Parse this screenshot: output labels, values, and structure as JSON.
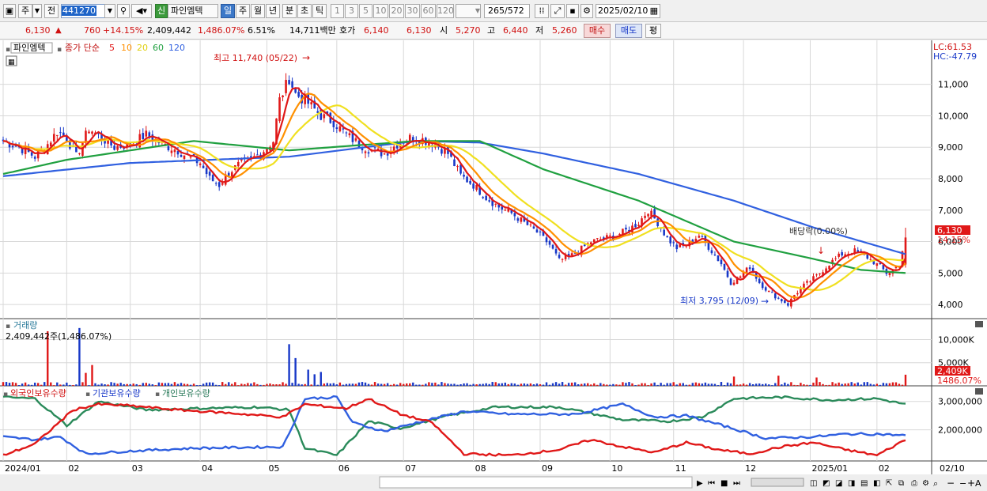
{
  "toolbar": {
    "dir_prev": "주",
    "dir_next": "전",
    "code": "441270",
    "stock_badge": "신",
    "stock_name": "파인엠텍",
    "periods": [
      "일",
      "주",
      "월",
      "년",
      "분",
      "초",
      "틱"
    ],
    "numbers": [
      "1",
      "3",
      "5",
      "10",
      "20",
      "30",
      "60",
      "120"
    ],
    "count": "265",
    "total": "/572",
    "date": "2025/02/10"
  },
  "quote": {
    "price": "6,130",
    "change": "760",
    "change_pct": "+14.15%",
    "volume": "2,409,442",
    "volume_pct": "1,486.07%",
    "turnover_pct": "6.51%",
    "amount": "14,711백만",
    "ask_label": "호가",
    "ask": "6,140",
    "bid": "6,130",
    "open_label": "시",
    "open": "5,270",
    "high_label": "고",
    "high": "6,440",
    "low_label": "저",
    "low": "5,260",
    "buy_label": "매수",
    "sell_label": "매도",
    "avg_label": "평"
  },
  "colors": {
    "up": "#e01818",
    "down": "#1838c8",
    "ma5": "#e01818",
    "ma10": "#ff9000",
    "ma20": "#f0e020",
    "ma60": "#20a040",
    "ma120": "#3060e0"
  },
  "chart_data": {
    "type": "line",
    "price_panel": {
      "legend": {
        "name": "파인엠텍",
        "series_label": "종가 단순",
        "periods": [
          "5",
          "10",
          "20",
          "60",
          "120"
        ]
      },
      "yticks": [
        "11,000",
        "10,000",
        "9,000",
        "8,000",
        "7,000",
        "6,000",
        "5,000",
        "4,000"
      ],
      "ytick_values": [
        11000,
        10000,
        9000,
        8000,
        7000,
        6000,
        5000,
        4000
      ],
      "ylim": [
        3550,
        12400
      ],
      "lc": "LC:61.53",
      "hc": "HC:-47.79",
      "last_price_label": "6,130",
      "last_pct_label": "14.15%",
      "max_label": "최고 11,740 (05/22)",
      "min_label": "최저 3,795 (12/09)",
      "dividend_label": "배당락(0.00%)",
      "close_anchor": [
        [
          0,
          9200
        ],
        [
          5,
          9000
        ],
        [
          10,
          8700
        ],
        [
          14,
          9100
        ],
        [
          17,
          9500
        ],
        [
          20,
          9300
        ],
        [
          23,
          8700
        ],
        [
          27,
          9600
        ],
        [
          31,
          9300
        ],
        [
          35,
          9000
        ],
        [
          40,
          9100
        ],
        [
          45,
          9400
        ],
        [
          50,
          9100
        ],
        [
          55,
          8900
        ],
        [
          58,
          8700
        ],
        [
          62,
          8500
        ],
        [
          65,
          8000
        ],
        [
          68,
          7800
        ],
        [
          71,
          8200
        ],
        [
          75,
          8500
        ],
        [
          78,
          8600
        ],
        [
          82,
          8900
        ],
        [
          85,
          9200
        ],
        [
          87,
          10500
        ],
        [
          90,
          11200
        ],
        [
          92,
          10700
        ],
        [
          96,
          10400
        ],
        [
          100,
          10000
        ],
        [
          104,
          9800
        ],
        [
          108,
          9400
        ],
        [
          112,
          9100
        ],
        [
          116,
          8900
        ],
        [
          120,
          8800
        ],
        [
          124,
          9100
        ],
        [
          128,
          9300
        ],
        [
          132,
          9250
        ],
        [
          136,
          9100
        ],
        [
          140,
          8800
        ],
        [
          144,
          8100
        ],
        [
          148,
          7800
        ],
        [
          152,
          7400
        ],
        [
          156,
          7100
        ],
        [
          160,
          6900
        ],
        [
          164,
          6600
        ],
        [
          168,
          6300
        ],
        [
          172,
          5900
        ],
        [
          175,
          5400
        ],
        [
          178,
          5500
        ],
        [
          181,
          5700
        ],
        [
          185,
          6000
        ],
        [
          189,
          6100
        ],
        [
          193,
          6200
        ],
        [
          197,
          6400
        ],
        [
          200,
          6600
        ],
        [
          203,
          7000
        ],
        [
          206,
          6600
        ],
        [
          209,
          6100
        ],
        [
          212,
          5800
        ],
        [
          215,
          5900
        ],
        [
          219,
          6200
        ],
        [
          223,
          5700
        ],
        [
          226,
          5300
        ],
        [
          229,
          4700
        ],
        [
          232,
          4900
        ],
        [
          235,
          5200
        ],
        [
          238,
          4700
        ],
        [
          241,
          4400
        ],
        [
          244,
          4200
        ],
        [
          247,
          4000
        ],
        [
          249,
          4300
        ],
        [
          252,
          4600
        ],
        [
          256,
          4900
        ],
        [
          260,
          5300
        ],
        [
          264,
          5600
        ],
        [
          268,
          5700
        ],
        [
          272,
          5500
        ],
        [
          276,
          5200
        ],
        [
          278,
          5000
        ],
        [
          280,
          5100
        ],
        [
          282,
          5300
        ],
        [
          284,
          6130
        ]
      ],
      "ma120_anchor": [
        [
          0,
          8080
        ],
        [
          40,
          8500
        ],
        [
          90,
          8700
        ],
        [
          130,
          9200
        ],
        [
          150,
          9150
        ],
        [
          170,
          8800
        ],
        [
          200,
          8150
        ],
        [
          230,
          7300
        ],
        [
          255,
          6450
        ],
        [
          284,
          5600
        ]
      ],
      "ma60_anchor": [
        [
          0,
          8150
        ],
        [
          20,
          8600
        ],
        [
          60,
          9200
        ],
        [
          90,
          8900
        ],
        [
          130,
          9200
        ],
        [
          150,
          9200
        ],
        [
          170,
          8300
        ],
        [
          200,
          7300
        ],
        [
          230,
          6000
        ],
        [
          255,
          5450
        ],
        [
          270,
          5100
        ],
        [
          284,
          5000
        ]
      ]
    },
    "volume_panel": {
      "title": "거래량",
      "value_label": "2,409,442주(1,486.07%)",
      "yticks": [
        "10,000K",
        "5,000K"
      ],
      "ytick_values": [
        10000,
        5000
      ],
      "ylim": [
        0,
        13500
      ],
      "last_vol_label": "2,409K",
      "last_pct_label": "1486.07%",
      "spikes": [
        [
          14,
          11800
        ],
        [
          24,
          12500
        ],
        [
          28,
          4500
        ],
        [
          26,
          2800
        ],
        [
          90,
          9000
        ],
        [
          92,
          6000
        ],
        [
          96,
          3500
        ],
        [
          98,
          2500
        ],
        [
          100,
          3000
        ],
        [
          230,
          2000
        ],
        [
          244,
          2200
        ],
        [
          256,
          1800
        ],
        [
          284,
          2409
        ]
      ]
    },
    "holdings_panel": {
      "legend": [
        "외국인보유수량",
        "기관보유수량",
        "개인보유수량"
      ],
      "yticks": [
        "3,000,000",
        "2,000,000"
      ],
      "ytick_values": [
        3000000,
        2000000
      ],
      "ylim": [
        900000,
        3550000
      ],
      "foreign_anchor": [
        [
          0,
          1100000
        ],
        [
          10,
          1500000
        ],
        [
          22,
          2700000
        ],
        [
          30,
          2900000
        ],
        [
          40,
          2850000
        ],
        [
          55,
          2700000
        ],
        [
          70,
          2600000
        ],
        [
          88,
          2450000
        ],
        [
          95,
          2900000
        ],
        [
          108,
          2750000
        ],
        [
          115,
          3100000
        ],
        [
          125,
          2550000
        ],
        [
          135,
          2250000
        ],
        [
          145,
          1150000
        ],
        [
          160,
          1100000
        ],
        [
          175,
          1300000
        ],
        [
          185,
          1650000
        ],
        [
          195,
          1400000
        ],
        [
          205,
          1200000
        ],
        [
          215,
          1550000
        ],
        [
          225,
          1300000
        ],
        [
          235,
          1150000
        ],
        [
          245,
          1400000
        ],
        [
          255,
          1550000
        ],
        [
          265,
          1300000
        ],
        [
          275,
          1100000
        ],
        [
          284,
          1650000
        ]
      ],
      "institution_anchor": [
        [
          0,
          1750000
        ],
        [
          10,
          1650000
        ],
        [
          18,
          1750000
        ],
        [
          26,
          1150000
        ],
        [
          40,
          1250000
        ],
        [
          60,
          1350000
        ],
        [
          88,
          1400000
        ],
        [
          95,
          3100000
        ],
        [
          105,
          3150000
        ],
        [
          110,
          2250000
        ],
        [
          120,
          1950000
        ],
        [
          130,
          2250000
        ],
        [
          145,
          2650000
        ],
        [
          160,
          2550000
        ],
        [
          180,
          2550000
        ],
        [
          195,
          2900000
        ],
        [
          205,
          2450000
        ],
        [
          215,
          2500000
        ],
        [
          228,
          2100000
        ],
        [
          240,
          1700000
        ],
        [
          255,
          1750000
        ],
        [
          265,
          1850000
        ],
        [
          275,
          1850000
        ],
        [
          284,
          1800000
        ]
      ],
      "individual_anchor": [
        [
          0,
          3150000
        ],
        [
          10,
          3100000
        ],
        [
          20,
          2150000
        ],
        [
          30,
          3000000
        ],
        [
          45,
          2700000
        ],
        [
          60,
          2750000
        ],
        [
          80,
          2800000
        ],
        [
          90,
          2700000
        ],
        [
          95,
          1350000
        ],
        [
          105,
          1100000
        ],
        [
          115,
          2300000
        ],
        [
          125,
          2050000
        ],
        [
          140,
          2500000
        ],
        [
          155,
          2800000
        ],
        [
          175,
          2800000
        ],
        [
          195,
          2350000
        ],
        [
          210,
          2300000
        ],
        [
          220,
          2450000
        ],
        [
          230,
          3100000
        ],
        [
          245,
          3150000
        ],
        [
          260,
          3050000
        ],
        [
          275,
          3100000
        ],
        [
          284,
          2900000
        ]
      ]
    },
    "xlabels": [
      "2024/01",
      "02",
      "03",
      "04",
      "05",
      "06",
      "07",
      "08",
      "09",
      "10",
      "11",
      "12",
      "2025/01",
      "02",
      "02/10"
    ],
    "xlabel_index": [
      0,
      20,
      40,
      62,
      83,
      105,
      126,
      148,
      169,
      191,
      211,
      233,
      254,
      275,
      287
    ],
    "n_bars": 285
  }
}
